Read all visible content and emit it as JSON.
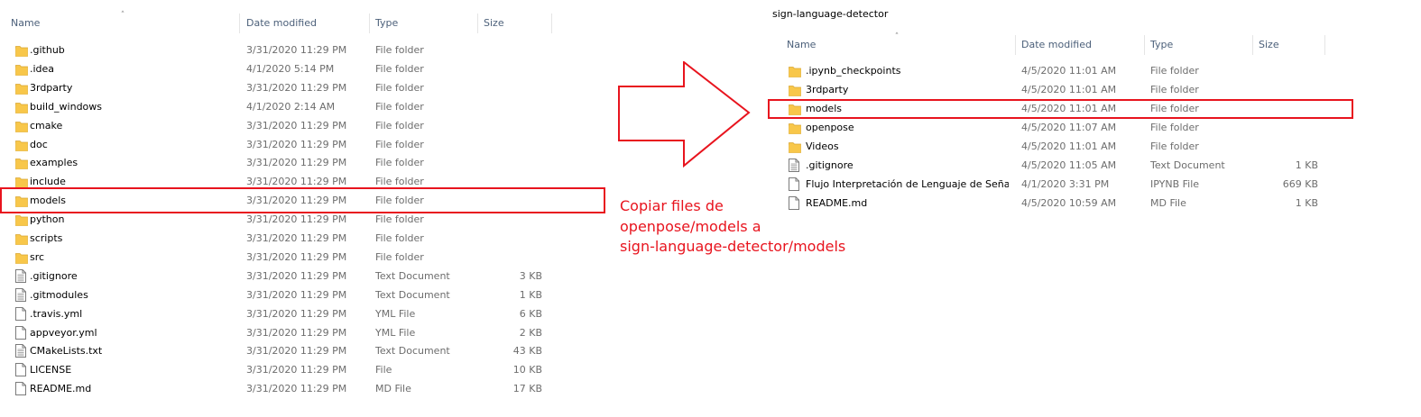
{
  "left_explorer": {
    "columns": {
      "name": "Name",
      "date": "Date modified",
      "type": "Type",
      "size": "Size"
    },
    "rows": [
      {
        "name": ".github",
        "date": "3/31/2020 11:29 PM",
        "type": "File folder",
        "size": "",
        "icon": "folder-icon"
      },
      {
        "name": ".idea",
        "date": "4/1/2020 5:14 PM",
        "type": "File folder",
        "size": "",
        "icon": "folder-icon"
      },
      {
        "name": "3rdparty",
        "date": "3/31/2020 11:29 PM",
        "type": "File folder",
        "size": "",
        "icon": "folder-icon"
      },
      {
        "name": "build_windows",
        "date": "4/1/2020 2:14 AM",
        "type": "File folder",
        "size": "",
        "icon": "folder-icon"
      },
      {
        "name": "cmake",
        "date": "3/31/2020 11:29 PM",
        "type": "File folder",
        "size": "",
        "icon": "folder-icon"
      },
      {
        "name": "doc",
        "date": "3/31/2020 11:29 PM",
        "type": "File folder",
        "size": "",
        "icon": "folder-icon"
      },
      {
        "name": "examples",
        "date": "3/31/2020 11:29 PM",
        "type": "File folder",
        "size": "",
        "icon": "folder-icon"
      },
      {
        "name": "include",
        "date": "3/31/2020 11:29 PM",
        "type": "File folder",
        "size": "",
        "icon": "folder-icon"
      },
      {
        "name": "models",
        "date": "3/31/2020 11:29 PM",
        "type": "File folder",
        "size": "",
        "icon": "folder-icon"
      },
      {
        "name": "python",
        "date": "3/31/2020 11:29 PM",
        "type": "File folder",
        "size": "",
        "icon": "folder-icon"
      },
      {
        "name": "scripts",
        "date": "3/31/2020 11:29 PM",
        "type": "File folder",
        "size": "",
        "icon": "folder-icon"
      },
      {
        "name": "src",
        "date": "3/31/2020 11:29 PM",
        "type": "File folder",
        "size": "",
        "icon": "folder-icon"
      },
      {
        "name": ".gitignore",
        "date": "3/31/2020 11:29 PM",
        "type": "Text Document",
        "size": "3 KB",
        "icon": "text-file-icon"
      },
      {
        "name": ".gitmodules",
        "date": "3/31/2020 11:29 PM",
        "type": "Text Document",
        "size": "1 KB",
        "icon": "text-file-icon"
      },
      {
        "name": ".travis.yml",
        "date": "3/31/2020 11:29 PM",
        "type": "YML File",
        "size": "6 KB",
        "icon": "file-icon"
      },
      {
        "name": "appveyor.yml",
        "date": "3/31/2020 11:29 PM",
        "type": "YML File",
        "size": "2 KB",
        "icon": "file-icon"
      },
      {
        "name": "CMakeLists.txt",
        "date": "3/31/2020 11:29 PM",
        "type": "Text Document",
        "size": "43 KB",
        "icon": "text-file-icon"
      },
      {
        "name": "LICENSE",
        "date": "3/31/2020 11:29 PM",
        "type": "File",
        "size": "10 KB",
        "icon": "file-icon"
      },
      {
        "name": "README.md",
        "date": "3/31/2020 11:29 PM",
        "type": "MD File",
        "size": "17 KB",
        "icon": "file-icon"
      }
    ]
  },
  "right_explorer": {
    "title": "sign-language-detector",
    "columns": {
      "name": "Name",
      "date": "Date modified",
      "type": "Type",
      "size": "Size"
    },
    "rows": [
      {
        "name": ".ipynb_checkpoints",
        "date": "4/5/2020 11:01 AM",
        "type": "File folder",
        "size": "",
        "icon": "folder-icon"
      },
      {
        "name": "3rdparty",
        "date": "4/5/2020 11:01 AM",
        "type": "File folder",
        "size": "",
        "icon": "folder-icon"
      },
      {
        "name": "models",
        "date": "4/5/2020 11:01 AM",
        "type": "File folder",
        "size": "",
        "icon": "folder-icon"
      },
      {
        "name": "openpose",
        "date": "4/5/2020 11:07 AM",
        "type": "File folder",
        "size": "",
        "icon": "folder-icon"
      },
      {
        "name": "Videos",
        "date": "4/5/2020 11:01 AM",
        "type": "File folder",
        "size": "",
        "icon": "folder-icon"
      },
      {
        "name": ".gitignore",
        "date": "4/5/2020 11:05 AM",
        "type": "Text Document",
        "size": "1 KB",
        "icon": "text-file-icon"
      },
      {
        "name": "Flujo Interpretación de Lenguaje de Seña...",
        "date": "4/1/2020 3:31 PM",
        "type": "IPYNB File",
        "size": "669 KB",
        "icon": "file-icon"
      },
      {
        "name": "README.md",
        "date": "4/5/2020 10:59 AM",
        "type": "MD File",
        "size": "1 KB",
        "icon": "file-icon"
      }
    ]
  },
  "annotation": {
    "lines": [
      "Copiar files de",
      "openpose/models a",
      "sign-language-detector/models"
    ],
    "color": "#e8141e"
  },
  "colors": {
    "folder": "#f8c74a",
    "highlight": "#e8141e",
    "header_text": "#4c607a"
  }
}
